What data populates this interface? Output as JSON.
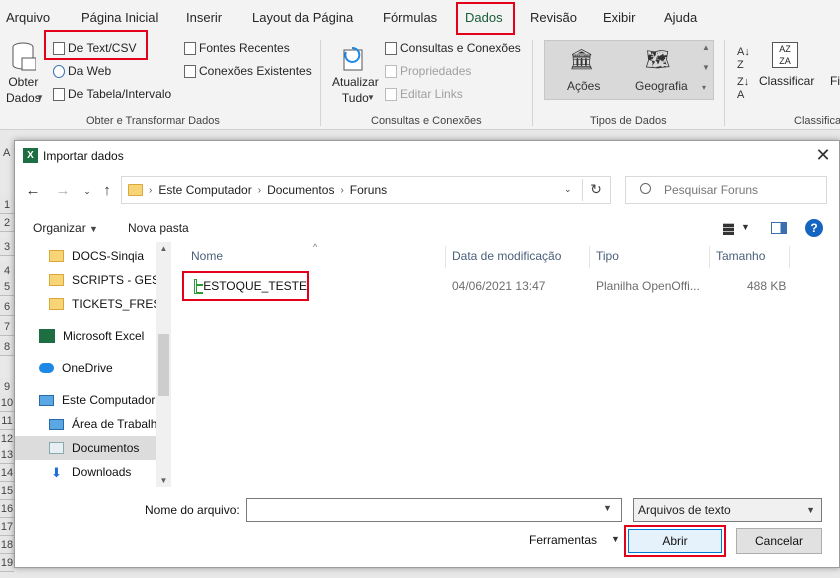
{
  "ribbon": {
    "tabs": [
      "Arquivo",
      "Página Inicial",
      "Inserir",
      "Layout da Página",
      "Fórmulas",
      "Dados",
      "Revisão",
      "Exibir",
      "Ajuda"
    ],
    "active_tab": "Dados",
    "get_data": {
      "line1": "Obter",
      "line2": "Dados"
    },
    "from_text_csv": "De Text/CSV",
    "from_web": "Da Web",
    "from_table": "De Tabela/Intervalo",
    "recent_sources": "Fontes Recentes",
    "existing_connections": "Conexões Existentes",
    "group_get_transform": "Obter e Transformar Dados",
    "refresh_all": {
      "line1": "Atualizar",
      "line2": "Tudo"
    },
    "queries_connections": "Consultas e Conexões",
    "properties": "Propriedades",
    "edit_links": "Editar Links",
    "group_queries": "Consultas e Conexões",
    "stocks": "Ações",
    "geography": "Geografia",
    "group_data_types": "Tipos de Dados",
    "sort": "Classificar",
    "filter_partial": "Fi",
    "group_sort_partial": "Classifica"
  },
  "sheet": {
    "column_letter_partial": "A",
    "row_numbers": [
      "1",
      "2",
      "3",
      "4",
      "5",
      "6",
      "7",
      "8",
      "9",
      "10",
      "11",
      "12",
      "13",
      "14",
      "15",
      "16",
      "17",
      "18",
      "19"
    ]
  },
  "dialog": {
    "title": "Importar dados",
    "address": [
      "Este Computador",
      "Documentos",
      "Foruns"
    ],
    "search_placeholder": "Pesquisar Foruns",
    "organize": "Organizar",
    "new_folder": "Nova pasta",
    "nav_items": [
      {
        "label": "DOCS-Sinqia",
        "icon": "folder-icon"
      },
      {
        "label": "SCRIPTS - GESTA",
        "icon": "folder-icon"
      },
      {
        "label": "TICKETS_FRESH",
        "icon": "folder-icon"
      },
      {
        "label": "Microsoft Excel",
        "icon": "excel-icon"
      },
      {
        "label": "OneDrive",
        "icon": "cloud-icon"
      },
      {
        "label": "Este Computador",
        "icon": "computer-icon"
      },
      {
        "label": "Área de Trabalho",
        "icon": "folder-icon"
      },
      {
        "label": "Documentos",
        "icon": "documents-icon"
      },
      {
        "label": "Downloads",
        "icon": "download-icon"
      }
    ],
    "columns": [
      "Nome",
      "Data de modificação",
      "Tipo",
      "Tamanho"
    ],
    "files": [
      {
        "name": "ESTOQUE_TESTE",
        "modified": "04/06/2021 13:47",
        "type": "Planilha OpenOffi...",
        "size": "488 KB"
      }
    ],
    "filename_label": "Nome do arquivo:",
    "filename_value": "",
    "filetype": "Arquivos de texto",
    "tools": "Ferramentas",
    "open": "Abrir",
    "cancel": "Cancelar"
  },
  "colors": {
    "highlight_red": "#e3001b",
    "excel_green": "#1d6f42",
    "selection_gray": "#dcdcdc",
    "primary_blue": "#0078d7"
  }
}
